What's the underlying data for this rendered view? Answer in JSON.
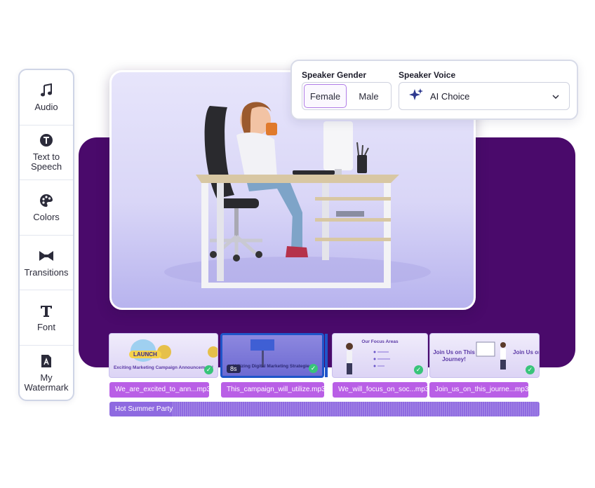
{
  "toolbar": {
    "items": [
      {
        "label": "Audio",
        "icon": "music-note-icon"
      },
      {
        "label": "Text to Speech",
        "icon": "text-to-speech-icon"
      },
      {
        "label": "Colors",
        "icon": "palette-icon"
      },
      {
        "label": "Transitions",
        "icon": "bowtie-icon"
      },
      {
        "label": "Font",
        "icon": "font-t-icon"
      },
      {
        "label": "My Watermark",
        "icon": "document-a-icon"
      }
    ]
  },
  "speaker": {
    "gender_heading": "Speaker Gender",
    "voice_heading": "Speaker Voice",
    "gender_options": [
      "Female",
      "Male"
    ],
    "selected_gender": "Female",
    "voice_value": "AI Choice"
  },
  "timeline": {
    "clips": [
      {
        "caption": "Exciting Marketing Campaign Announcement!",
        "badge": "LAUNCH"
      },
      {
        "caption": "Utilizing Digital Marketing Strategies",
        "duration": "8s"
      },
      {
        "caption": "Our Focus Areas"
      },
      {
        "caption": "Join Us on This Journey!"
      }
    ],
    "audio_tracks": [
      "We_are_excited_to_ann...mp3",
      "This_campaign_will_utilize.mp3",
      "We_will_focus_on_soc...mp3",
      "Join_us_on_this_journe...mp3"
    ],
    "music_track": "Hot Summer Party"
  },
  "colors": {
    "backdrop": "#4a0a6b",
    "selection": "#1f55c9",
    "audio_track": "#b95fe6",
    "music_track": "#8e6ae0",
    "check": "#38c47a"
  }
}
